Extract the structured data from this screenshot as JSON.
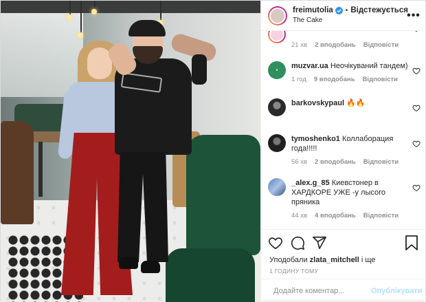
{
  "post": {
    "username": "freimutolia",
    "follow_label": "Відстежується",
    "location": "The Cake",
    "more_glyph": "•••"
  },
  "colors": {
    "text": "#262626",
    "meta": "#8e8e8e",
    "verified": "#3897f0",
    "post_button_disabled": "#b2dffc",
    "like_heart": "#262626"
  },
  "comments": [
    {
      "username": "",
      "text": "",
      "time": "21 хв",
      "likes": "2 вподобань",
      "reply": "Відповісти",
      "avatar": "pink-avatar",
      "partially_hidden": true
    },
    {
      "username": "muzvar.ua",
      "text": "Неочікуваний тандем)",
      "time": "1 год",
      "likes": "9 вподобань",
      "reply": "Відповісти",
      "avatar": "muzvar-logo-avatar"
    },
    {
      "username": "barkovskypaul",
      "text": "🔥🔥",
      "time": "1 год",
      "likes": "2 вподобань",
      "reply": "Відповісти",
      "avatar": "dark-photo-avatar"
    },
    {
      "username": "tymoshenko1",
      "text": "Коллаборация года!!!!!",
      "time": "56 хв",
      "likes": "2 вподобань",
      "reply": "Відповісти",
      "avatar": "dark-photo-avatar"
    },
    {
      "username": "_alex.g_85",
      "text": "Киевстонер в ХАРДКОРЕ УЖЕ -у лысого пряника",
      "time": "44 хв",
      "likes": "4 вподобань",
      "reply": "Відповісти",
      "avatar": "blue-photo-avatar"
    }
  ],
  "actions": {
    "like_icon": "heart-icon",
    "comment_icon": "comment-icon",
    "share_icon": "share-icon",
    "save_icon": "bookmark-icon"
  },
  "likes_line": {
    "prefix": "Уподобали",
    "user": "zlata_mitchell",
    "suffix": "і ще"
  },
  "posted_time": "1 ГОДИНУ ТОМУ",
  "add_comment": {
    "placeholder": "Додайте коментар...",
    "post_label": "Опублікувати",
    "emoji_icon": "emoji-icon"
  }
}
